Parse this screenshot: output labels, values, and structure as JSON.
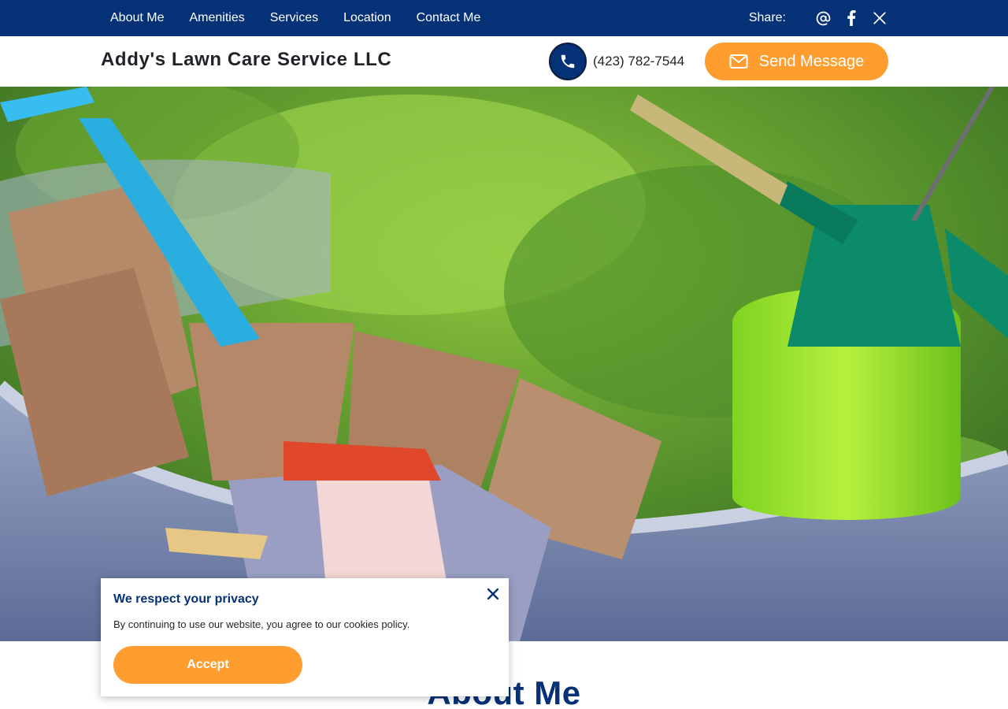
{
  "nav": {
    "items": [
      {
        "label": "About Me"
      },
      {
        "label": "Amenities"
      },
      {
        "label": "Services"
      },
      {
        "label": "Location"
      },
      {
        "label": "Contact Me"
      }
    ],
    "share_label": "Share:",
    "share_icons": [
      "email-at-icon",
      "facebook-icon",
      "x-twitter-icon"
    ]
  },
  "header": {
    "brand": "Addy's Lawn Care Service LLC",
    "phone_icon": "phone-icon",
    "phone": "(423) 782-7544",
    "send_label": "Send Message",
    "send_icon": "envelope-icon"
  },
  "hero": {
    "image": "garden-tools-wheelbarrow-photo"
  },
  "about": {
    "title": "About Me"
  },
  "privacy": {
    "title": "We respect your privacy",
    "text": "By continuing to use our website, you agree to our cookies policy.",
    "accept_label": "Accept",
    "close_icon": "close-icon"
  },
  "colors": {
    "navy": "#053276",
    "accent": "#ff9d2e",
    "text": "#1f2328"
  }
}
